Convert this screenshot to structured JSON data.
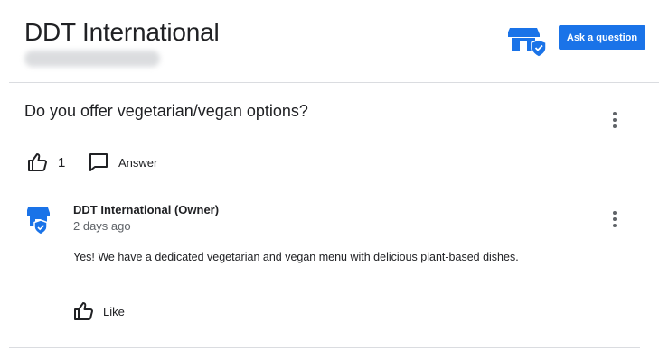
{
  "header": {
    "title": "DDT International",
    "store_icon": "store-verified-icon",
    "ask_button_label": "Ask a question"
  },
  "question": {
    "text": "Do you offer vegetarian/vegan options?",
    "upvotes": "1",
    "answer_label": "Answer",
    "menu_icon": "more-vert-icon"
  },
  "answer": {
    "author": "DDT International (Owner)",
    "time": "2 days ago",
    "text": "Yes! We have a dedicated vegetarian and vegan menu with delicious plant-based dishes.",
    "like_label": "Like",
    "menu_icon": "more-vert-icon"
  },
  "colors": {
    "accent": "#1a73e8",
    "icon_gray": "#202124",
    "divider": "#dadce0"
  }
}
